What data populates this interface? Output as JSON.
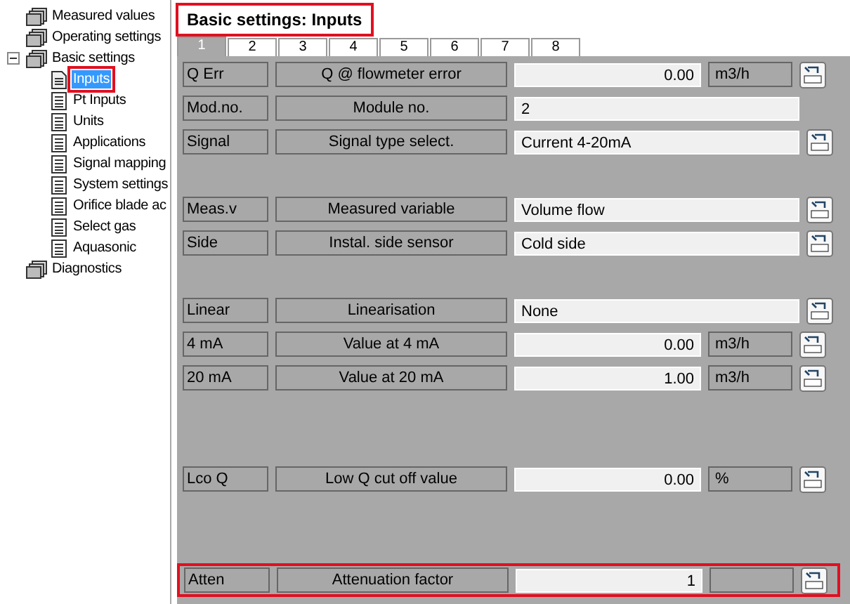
{
  "tree": [
    {
      "label": "Measured values",
      "kind": "folder",
      "selected": false,
      "highlighted": false
    },
    {
      "label": "Operating settings",
      "kind": "folder",
      "selected": false,
      "highlighted": false
    },
    {
      "label": "Basic settings",
      "kind": "folder",
      "selected": false,
      "highlighted": false,
      "expanded": true,
      "children": [
        {
          "label": "Inputs",
          "kind": "page",
          "selected": true,
          "highlighted": true
        },
        {
          "label": "Pt Inputs",
          "kind": "list",
          "selected": false,
          "highlighted": false
        },
        {
          "label": "Units",
          "kind": "list",
          "selected": false,
          "highlighted": false
        },
        {
          "label": "Applications",
          "kind": "list",
          "selected": false,
          "highlighted": false
        },
        {
          "label": "Signal mapping",
          "kind": "list",
          "selected": false,
          "highlighted": false
        },
        {
          "label": "System settings",
          "kind": "list",
          "selected": false,
          "highlighted": false
        },
        {
          "label": "Orifice blade ac",
          "kind": "list",
          "selected": false,
          "highlighted": false
        },
        {
          "label": "Select gas",
          "kind": "list",
          "selected": false,
          "highlighted": false
        },
        {
          "label": "Aquasonic",
          "kind": "list",
          "selected": false,
          "highlighted": false
        }
      ]
    },
    {
      "label": "Diagnostics",
      "kind": "folder",
      "selected": false,
      "highlighted": false
    }
  ],
  "title": {
    "text": "Basic settings:  Inputs",
    "highlighted": true
  },
  "tabs": [
    {
      "label": "1",
      "selected": true
    },
    {
      "label": "2",
      "selected": false
    },
    {
      "label": "3",
      "selected": false
    },
    {
      "label": "4",
      "selected": false
    },
    {
      "label": "5",
      "selected": false
    },
    {
      "label": "6",
      "selected": false
    },
    {
      "label": "7",
      "selected": false
    },
    {
      "label": "8",
      "selected": false
    }
  ],
  "rows": [
    {
      "kind": "number",
      "code": "Q Err",
      "name": "Q @ flowmeter error",
      "value": "0.00",
      "unit": "m3/h",
      "editable": true,
      "highlighted": false
    },
    {
      "kind": "text",
      "code": "Mod.no.",
      "name": "Module no.",
      "value": "2",
      "editable": false,
      "highlighted": false
    },
    {
      "kind": "text",
      "code": "Signal",
      "name": "Signal type select.",
      "value": "Current 4-20mA",
      "editable": true,
      "highlighted": false
    },
    {
      "kind": "spacer"
    },
    {
      "kind": "text",
      "code": "Meas.v",
      "name": "Measured variable",
      "value": "Volume flow",
      "editable": true,
      "highlighted": false
    },
    {
      "kind": "text",
      "code": "Side",
      "name": "Instal. side sensor",
      "value": "Cold side",
      "editable": true,
      "highlighted": false
    },
    {
      "kind": "spacer"
    },
    {
      "kind": "text",
      "code": "Linear",
      "name": "Linearisation",
      "value": "None",
      "editable": true,
      "highlighted": false
    },
    {
      "kind": "number",
      "code": "4 mA",
      "name": "Value at 4 mA",
      "value": "0.00",
      "unit": "m3/h",
      "editable": true,
      "highlighted": false
    },
    {
      "kind": "number",
      "code": "20 mA",
      "name": "Value at 20 mA",
      "value": "1.00",
      "unit": "m3/h",
      "editable": true,
      "highlighted": false
    },
    {
      "kind": "spacer"
    },
    {
      "kind": "spacer"
    },
    {
      "kind": "number",
      "code": "Lco Q",
      "name": "Low Q cut off value",
      "value": "0.00",
      "unit": "%",
      "editable": true,
      "highlighted": false
    },
    {
      "kind": "spacer"
    },
    {
      "kind": "spacer"
    },
    {
      "kind": "number",
      "code": "Atten",
      "name": "Attenuation factor",
      "value": "1",
      "editable": true,
      "highlighted": true
    }
  ]
}
